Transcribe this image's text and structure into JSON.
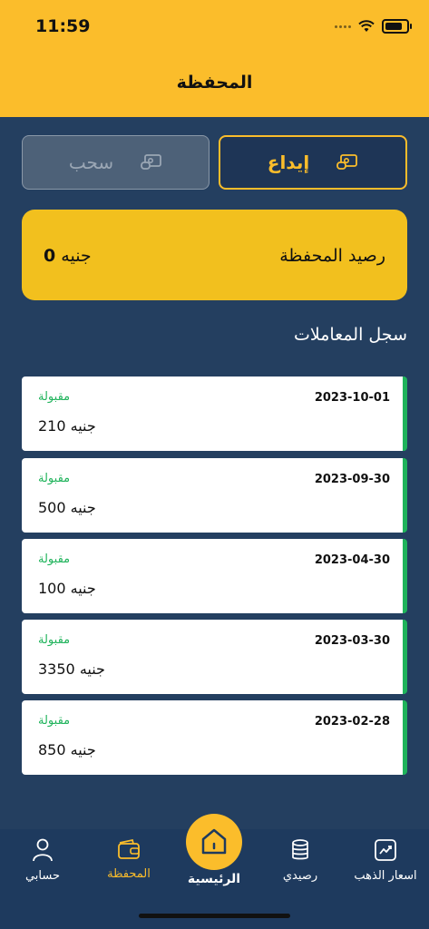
{
  "status_bar": {
    "time": "11:59"
  },
  "header": {
    "title": "المحفظة"
  },
  "actions": {
    "deposit_label": "إيداع",
    "withdraw_label": "سحب"
  },
  "balance": {
    "label": "رصيد المحفظة",
    "amount": "0",
    "currency": "جنيه"
  },
  "history": {
    "title": "سجل المعاملات",
    "items": [
      {
        "date": "2023-10-01",
        "status": "مقبولة",
        "amount": "210 جنيه"
      },
      {
        "date": "2023-09-30",
        "status": "مقبولة",
        "amount": "500 جنيه"
      },
      {
        "date": "2023-04-30",
        "status": "مقبولة",
        "amount": "100 جنيه"
      },
      {
        "date": "2023-03-30",
        "status": "مقبولة",
        "amount": "3350 جنيه"
      },
      {
        "date": "2023-02-28",
        "status": "مقبولة",
        "amount": "850 جنيه"
      }
    ]
  },
  "tabbar": {
    "account": "حسابي",
    "wallet": "المحفظة",
    "home": "الرئيسية",
    "my_balance": "رصيدي",
    "gold_prices": "اسعار الذهب"
  },
  "colors": {
    "primary": "#fbbd2b",
    "background": "#243f60",
    "success": "#1fb35b"
  }
}
